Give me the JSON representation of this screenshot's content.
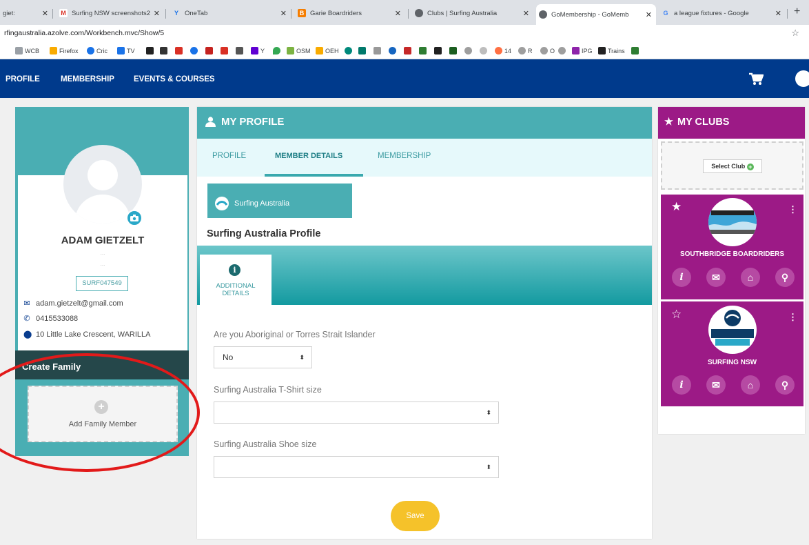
{
  "browser": {
    "tabs": [
      {
        "label": "giet:",
        "icon": "tab-partial-icon"
      },
      {
        "label": "Surfing NSW screenshots2",
        "icon": "gmail-icon"
      },
      {
        "label": "OneTab",
        "icon": "onetab-icon"
      },
      {
        "label": "Garie Boardriders",
        "icon": "blogger-icon"
      },
      {
        "label": "Clubs | Surfing Australia",
        "icon": "globe-icon"
      },
      {
        "label": "GoMembership - GoMemb",
        "icon": "globe-icon"
      },
      {
        "label": "a league fixtures - Google",
        "icon": "google-icon"
      }
    ],
    "url": "rfingaustralia.azolve.com/Workbench.mvc/Show/5",
    "bookmarks": [
      "WCB",
      "Firefox",
      "Cric",
      "TV",
      "Y",
      "OSM",
      "OEH",
      "14",
      "R",
      "O",
      "IPG",
      "Trains"
    ]
  },
  "nav": {
    "items": [
      "PROFILE",
      "MEMBERSHIP",
      "EVENTS & COURSES"
    ]
  },
  "profile_card": {
    "name": "ADAM GIETZELT",
    "dots1": "...",
    "dots2": "...",
    "member_id": "SURF047549",
    "email": "adam.gietzelt@gmail.com",
    "phone": "0415533088",
    "address": "10 Little Lake Crescent, WARILLA",
    "family_title": "Create Family",
    "add_family": "Add Family Member"
  },
  "main": {
    "title": "MY PROFILE",
    "tabs": [
      "PROFILE",
      "MEMBER DETAILS",
      "MEMBERSHIP"
    ],
    "active_tab": "MEMBER DETAILS",
    "org_button": "Surfing Australia",
    "section_title": "Surfing Australia Profile",
    "sub_tab_line1": "ADDITIONAL",
    "sub_tab_line2": "DETAILS",
    "fields": [
      {
        "label": "Are you Aboriginal or Torres Strait Islander",
        "value": "No"
      },
      {
        "label": "Surfing Australia T-Shirt size",
        "value": ""
      },
      {
        "label": "Surfing Australia Shoe size",
        "value": ""
      }
    ],
    "save": "Save"
  },
  "clubs": {
    "title": "MY CLUBS",
    "select_club": "Select Club",
    "items": [
      {
        "name": "SOUTHBRIDGE BOARDRIDERS",
        "favourite": true,
        "logo_text": "SOUTHBRIDGE BOARD RIDERS"
      },
      {
        "name": "SURFING NSW",
        "favourite": false,
        "logo_text": "SURFING NSW"
      }
    ]
  },
  "colors": {
    "teal": "#4aaeb3",
    "navy": "#003a8c",
    "purple": "#9c1a86",
    "save": "#f5c22a",
    "annotation_red": "#e21a1a"
  }
}
